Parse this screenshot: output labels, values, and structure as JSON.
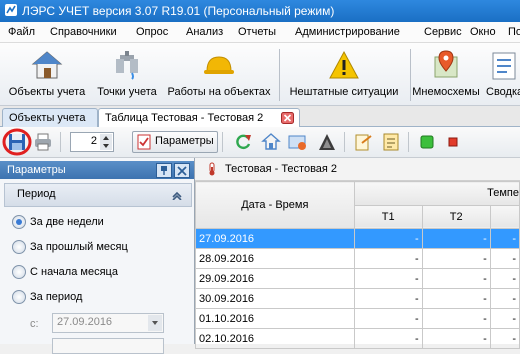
{
  "window": {
    "title": "ЛЭРС УЧЕТ версия 3.07 R19.01 (Персональный режим)"
  },
  "menu": [
    "Файл",
    "Справочники",
    "Опрос",
    "Анализ",
    "Отчеты",
    "Администрирование",
    "Сервис",
    "Окно",
    "По"
  ],
  "big_toolbar": [
    {
      "label": "Объекты учета",
      "icon": "house-icon"
    },
    {
      "label": "Точки учета",
      "icon": "tap-icon"
    },
    {
      "label": "Работы на объектах",
      "icon": "hardhat-icon"
    },
    {
      "label": "Нештатные ситуации",
      "icon": "warning-icon"
    },
    {
      "label": "Мнемосхемы",
      "icon": "map-pin-icon"
    },
    {
      "label": "Сводка",
      "icon": "summary-icon"
    }
  ],
  "tabs": [
    {
      "label": "Объекты учета"
    },
    {
      "label": "Таблица Тестовая - Тестовая 2"
    }
  ],
  "small_toolbar": {
    "spinner_value": "2",
    "params_label": "Параметры"
  },
  "left_panel": {
    "title": "Параметры",
    "group": "Период",
    "options": [
      "За две недели",
      "За прошлый месяц",
      "С начала месяца",
      "За период"
    ],
    "selected_index": 0,
    "from_label": "с:",
    "from_value": "27.09.2016"
  },
  "table": {
    "title": "Тестовая - Тестовая 2",
    "col_datetime": "Дата - Время",
    "col_group": "Темпе",
    "cols": [
      "T1",
      "T2"
    ],
    "rows": [
      {
        "date": "27.09.2016",
        "t1": "-",
        "t2": "-",
        "t3": "-"
      },
      {
        "date": "28.09.2016",
        "t1": "-",
        "t2": "-",
        "t3": "-"
      },
      {
        "date": "29.09.2016",
        "t1": "-",
        "t2": "-",
        "t3": "-"
      },
      {
        "date": "30.09.2016",
        "t1": "-",
        "t2": "-",
        "t3": "-"
      },
      {
        "date": "01.10.2016",
        "t1": "-",
        "t2": "-",
        "t3": "-"
      },
      {
        "date": "02.10.2016",
        "t1": "-",
        "t2": "-",
        "t3": "-"
      }
    ]
  },
  "colors": {
    "selection": "#3399ff",
    "title_bar": "#1a6fc4",
    "highlight_circle": "#e02020"
  }
}
